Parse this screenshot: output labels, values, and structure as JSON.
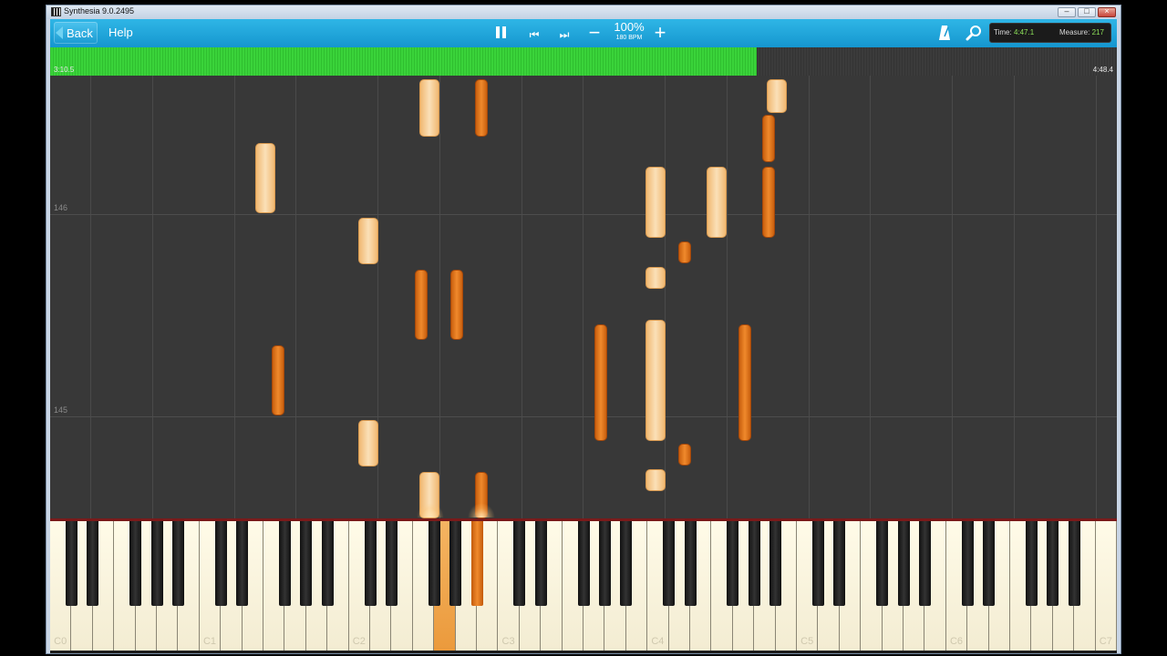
{
  "window": {
    "title": "Synthesia 9.0.2495",
    "minimize": "–",
    "maximize": "□",
    "close": "×"
  },
  "toolbar": {
    "back_label": "Back",
    "help_label": "Help",
    "prev_glyph": "⏮",
    "next_glyph": "⏭",
    "minus_glyph": "−",
    "plus_glyph": "+",
    "speed": "100%",
    "bpm": "180 BPM",
    "time_label": "Time:",
    "time_value": "4:47.1",
    "measure_label": "Measure:",
    "measure_value": "217"
  },
  "progress": {
    "start": "3:10.5",
    "end": "4:48.4",
    "fraction": 0.662
  },
  "roll": {
    "measure_upper": "146",
    "measure_lower": "145"
  },
  "keyboard": {
    "labels": [
      "C0",
      "C1",
      "C2",
      "C3",
      "C4",
      "C5",
      "C6",
      "C7"
    ],
    "pressed_keys": [
      "G2",
      "A#2"
    ]
  },
  "colors": {
    "accent": "#1a9fd6",
    "progress_green": "#34c934",
    "note_light": "#f7cf95",
    "note_dark": "#ee7f22"
  }
}
